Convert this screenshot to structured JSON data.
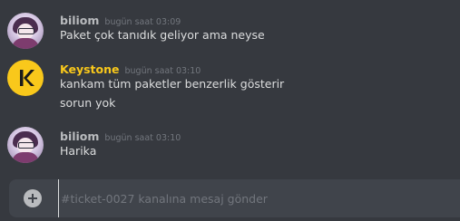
{
  "messages": [
    {
      "author": "biliom",
      "timestamp": "bugün saat 03:09",
      "lines": [
        "Paket çok tanıdık geliyor ama neyse"
      ]
    },
    {
      "author": "Keystone",
      "timestamp": "bugün saat 03:10",
      "lines": [
        "kankam tüm paketler benzerlik gösterir",
        "sorun yok"
      ]
    },
    {
      "author": "biliom",
      "timestamp": "bugün saat 03:10",
      "lines": [
        "Harika"
      ]
    }
  ],
  "composer": {
    "placeholder": "#ticket-0027 kanalına mesaj gönder"
  },
  "colors": {
    "background": "#36393f",
    "composer": "#40444b",
    "bot_name": "#f9c81b",
    "user_name": "#b9bbbe",
    "message_text": "#dcddde",
    "timestamp": "#72767d"
  }
}
